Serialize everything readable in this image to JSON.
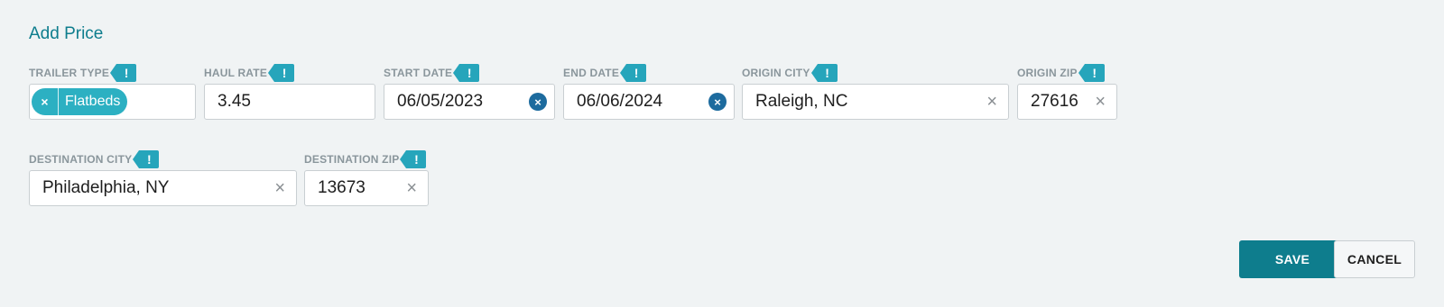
{
  "form": {
    "title": "Add Price",
    "flag_symbol": "!",
    "fields": {
      "trailer_type": {
        "label": "TRAILER TYPE",
        "chip_label": "Flatbeds",
        "chip_remove": "×"
      },
      "haul_rate": {
        "label": "HAUL RATE",
        "value": "3.45"
      },
      "start_date": {
        "label": "START DATE",
        "value": "06/05/2023",
        "clear": "×"
      },
      "end_date": {
        "label": "END DATE",
        "value": "06/06/2024",
        "clear": "×"
      },
      "origin_city": {
        "label": "ORIGIN CITY",
        "value": "Raleigh, NC",
        "clear": "×"
      },
      "origin_zip": {
        "label": "ORIGIN ZIP",
        "value": "27616",
        "clear": "×"
      },
      "destination_city": {
        "label": "DESTINATION CITY",
        "value": "Philadelphia, NY",
        "clear": "×"
      },
      "destination_zip": {
        "label": "DESTINATION ZIP",
        "value": "13673",
        "clear": "×"
      }
    },
    "actions": {
      "save_label": "SAVE",
      "cancel_label": "CANCEL"
    }
  },
  "colors": {
    "accent": "#0e7d8d",
    "flag": "#26a5bb",
    "chip": "#2cb0c2",
    "date_clear": "#1d6b9e",
    "background": "#f0f3f4"
  }
}
